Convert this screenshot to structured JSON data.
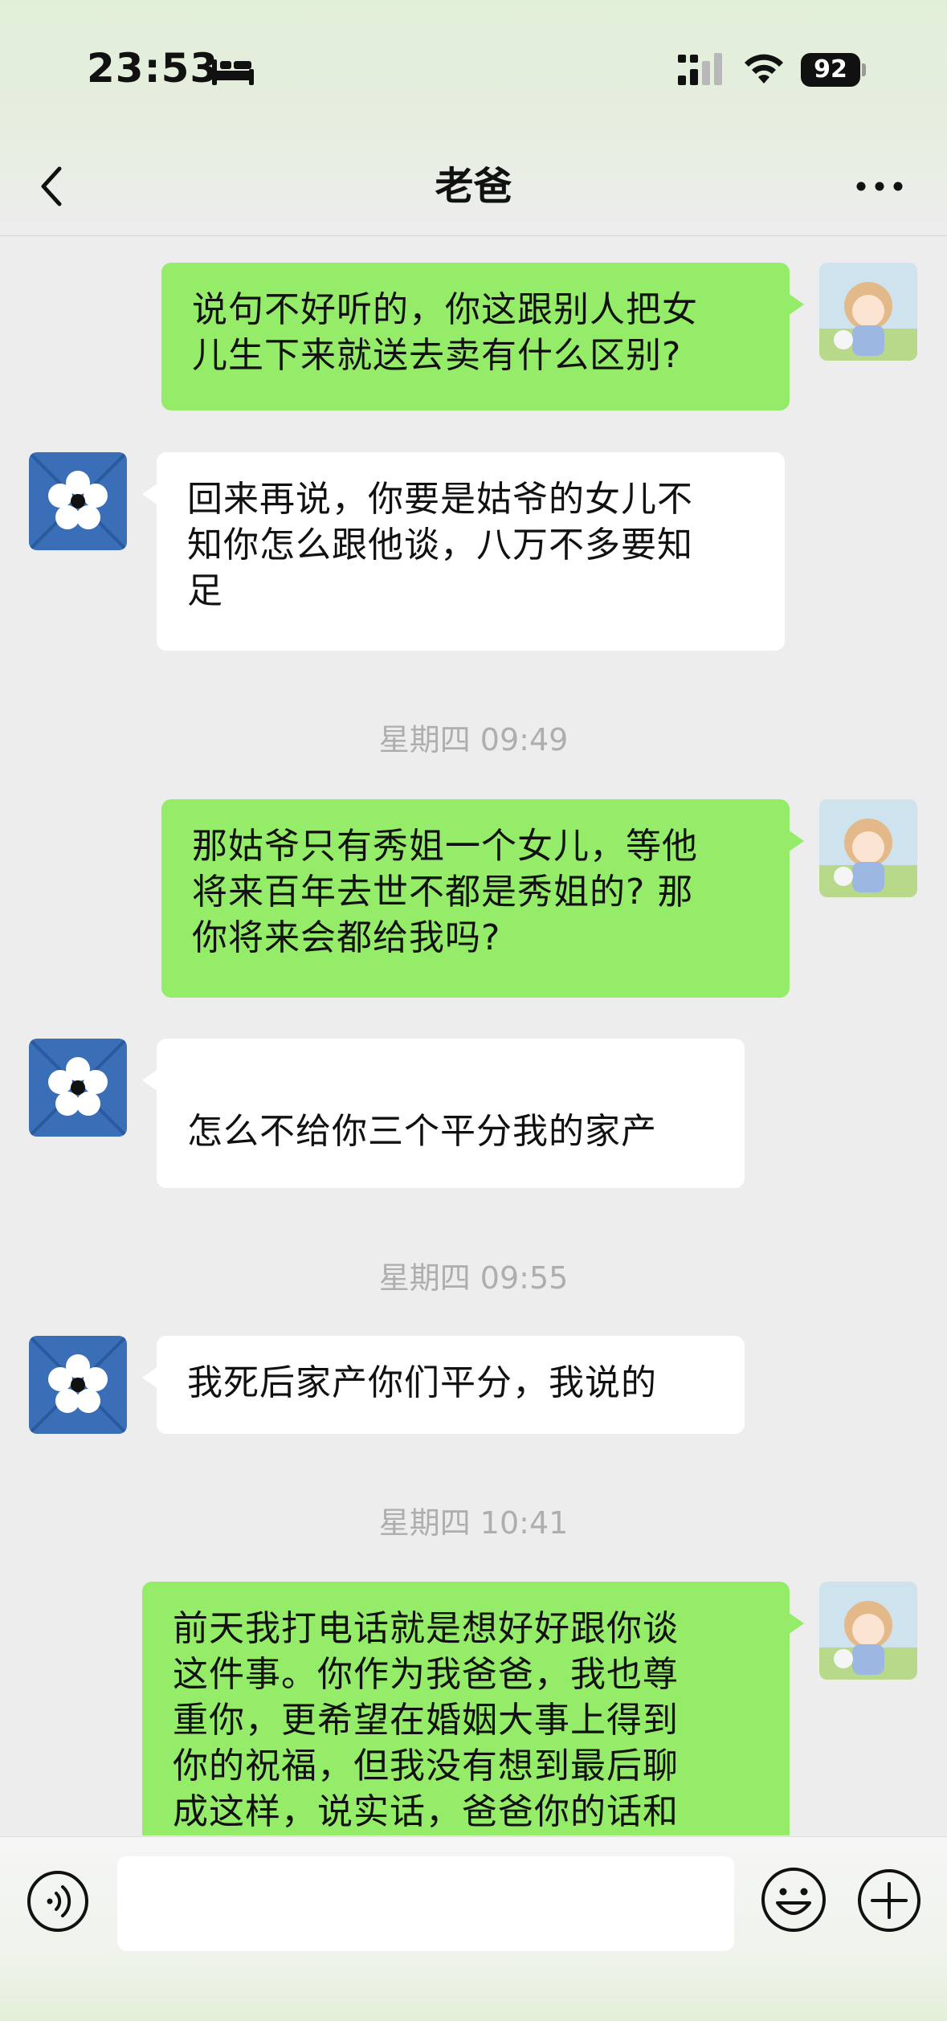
{
  "status_bar": {
    "time": "23:53",
    "battery": "92"
  },
  "header": {
    "title": "老爸"
  },
  "messages": [
    {
      "direction": "out",
      "text": "说句不好听的，你这跟别人把女\n儿生下来就送去卖有什么区别?"
    },
    {
      "direction": "in",
      "text": "回来再说，你要是姑爷的女儿不\n知你怎么跟他谈，八万不多要知\n足"
    },
    {
      "type": "timestamp",
      "text": "星期四 09:49"
    },
    {
      "direction": "out",
      "text": "那姑爷只有秀姐一个女儿，等他\n将来百年去世不都是秀姐的? 那\n你将来会都给我吗?"
    },
    {
      "direction": "in",
      "text": "\n怎么不给你三个平分我的家产"
    },
    {
      "type": "timestamp",
      "text": "星期四 09:55"
    },
    {
      "direction": "in",
      "text": "我死后家产你们平分，我说的"
    },
    {
      "type": "timestamp",
      "text": "星期四 10:41"
    },
    {
      "direction": "out",
      "text": "前天我打电话就是想好好跟你谈\n这件事。你作为我爸爸，我也尊\n重你，更希望在婚姻大事上得到\n你的祝福，但我没有想到最后聊\n成这样，说实话，爸爸你的话和"
    }
  ],
  "input": {
    "placeholder": ""
  },
  "colors": {
    "outgoing_bubble": "#95ec69",
    "incoming_bubble": "#ffffff",
    "background": "#ededed",
    "timestamp": "#aeaeae"
  },
  "icons": {
    "back": "chevron-left-icon",
    "more": "more-icon",
    "voice": "voice-icon",
    "emoji": "emoji-icon",
    "plus": "plus-icon"
  }
}
